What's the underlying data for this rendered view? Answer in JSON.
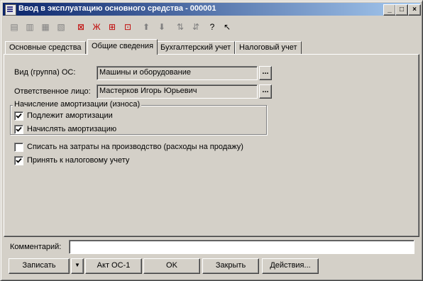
{
  "window": {
    "title": "Ввод в эксплуатацию основного средства - 000001"
  },
  "title_buttons": {
    "minimize": "_",
    "maximize": "□",
    "close": "×"
  },
  "toolbar_icons": [
    "add-row-icon",
    "copy-row-icon",
    "edit-row-icon",
    "delete-row-icon",
    "end-edit-icon",
    "unset-mark-icon",
    "set-mark-icon",
    "insert-icon",
    "move-up-icon",
    "move-down-icon",
    "sort-asc-icon",
    "sort-desc-icon",
    "help-icon",
    "context-help-icon"
  ],
  "tabs": [
    "Основные средства",
    "Общие сведения",
    "Бухгалтерский учет",
    "Налоговый учет"
  ],
  "form": {
    "group_os_label": "Вид (группа) ОС:",
    "group_os_value": "Машины и оборудование",
    "responsible_label": "Ответственное лицо:",
    "responsible_value": "Мастерков Игорь Юрьевич",
    "select_button": "...",
    "depreciation_group_title": "Начисление амортизации (износа)",
    "subject_to_depreciation": "Подлежит амортизации",
    "calc_depreciation": "Начислять амортизацию",
    "write_off_expenses": "Списать на затраты на производство (расходы на продажу)",
    "accept_tax": "Принять к налоговому учету"
  },
  "checkboxes": {
    "subject_to_depreciation": true,
    "calc_depreciation": true,
    "write_off_expenses": false,
    "accept_tax": true
  },
  "comment": {
    "label": "Комментарий:",
    "value": ""
  },
  "buttons": {
    "save": "Записать",
    "save_dropdown": "▼",
    "act": "Акт ОС-1",
    "ok": "OK",
    "close": "Закрыть",
    "actions": "Действия..."
  }
}
